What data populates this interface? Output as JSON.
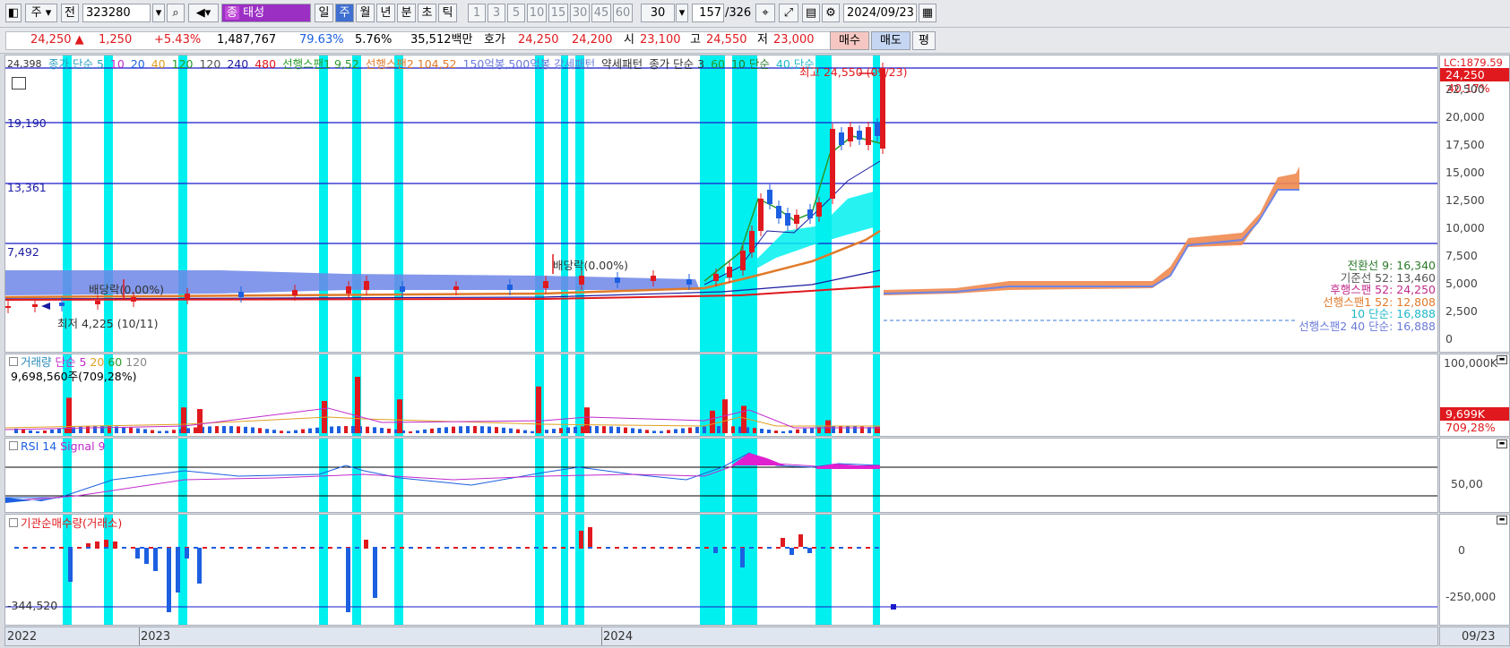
{
  "toolbar": {
    "view_label": "주",
    "prev_label": "전",
    "code": "323280",
    "stock_name": "태성",
    "stock_prefix": "종",
    "periods": [
      "일",
      "주",
      "월",
      "년",
      "분",
      "초",
      "틱"
    ],
    "active_period": "주",
    "minutes": [
      "1",
      "3",
      "5",
      "10",
      "15",
      "30",
      "45",
      "60"
    ],
    "interval_value": "30",
    "count": "157",
    "total": "/326",
    "date": "2024/09/23"
  },
  "quote": {
    "price": "24,250",
    "change": "1,250",
    "change_pct": "+5.43%",
    "volume": "1,487,767",
    "vol_ratio": "79.63%",
    "turnover": "5.76%",
    "amount": "35,512백만",
    "hoga_label": "호가",
    "ask": "24,250",
    "bid": "24,200",
    "open_label": "시",
    "open": "23,100",
    "high_label": "고",
    "high": "24,550",
    "low_label": "저",
    "low": "23,000",
    "buy_button": "매수",
    "sell_button": "매도",
    "eval_button": "평"
  },
  "price_panel": {
    "corner": "24,398",
    "legend": [
      "종가 단순 5",
      "10",
      "20",
      "40",
      "120",
      "120",
      "240",
      "480",
      "선행스팬1 9,52",
      "선행스팬2 104,52",
      "150억봉,500억봉 강세패턴",
      "약세패턴",
      "종가 단순 3",
      "60",
      "10 단순",
      "40,단순"
    ],
    "hlines": [
      "19,190",
      "13,361",
      "7,492"
    ],
    "dividend_1": "배당락(0.00%)",
    "dividend_2": "배당락(0.00%)",
    "low_note": "최저 4,225 (10/11)",
    "high_note": "최고 24,550 (09/23)",
    "indicators": [
      {
        "label": "전환선 9: 16,340",
        "color": "#2a7a2a"
      },
      {
        "label": "기준선 52: 13,460",
        "color": "#555555"
      },
      {
        "label": "후행스팬 52: 24,250",
        "color": "#c02a8a"
      },
      {
        "label": "선행스팬1 52: 12,808",
        "color": "#e07a2a"
      },
      {
        "label": "10 단순: 16,888",
        "color": "#20b8c8"
      },
      {
        "label": "선행스팬2 40 단순: 16,888",
        "color": "#6a7ad8"
      }
    ],
    "y_ticks": [
      "22,500",
      "20,000",
      "17,500",
      "15,000",
      "12,500",
      "10,000",
      "7,500",
      "5,000",
      "2,500",
      "0"
    ],
    "lc": "LC:1879.59",
    "last_price": "24,250",
    "last_pct": "40.17%"
  },
  "volume_panel": {
    "legend": [
      "거래량",
      "단순 5",
      "20",
      "60",
      "120"
    ],
    "value": "9,698,560주(709,28%)",
    "y_top": "100,000K",
    "last": "9,699K",
    "last_pct": "709,28%"
  },
  "rsi_panel": {
    "legend": [
      "RSI 14",
      "Signal 9"
    ],
    "y_mid": "50,00"
  },
  "inst_panel": {
    "legend": "기관순매수량(거래소)",
    "min_label": "-344,520",
    "y_ticks": [
      "0",
      "-250,000"
    ]
  },
  "x_axis": {
    "labels": [
      "2022",
      "2023",
      "2024"
    ],
    "right_label": "09/23"
  },
  "colors": {
    "up": "#e0191e",
    "down": "#1c5fe0",
    "highlight": "#00f0f0",
    "cloud": "#f08a50",
    "cloud2": "#6d86e8"
  }
}
